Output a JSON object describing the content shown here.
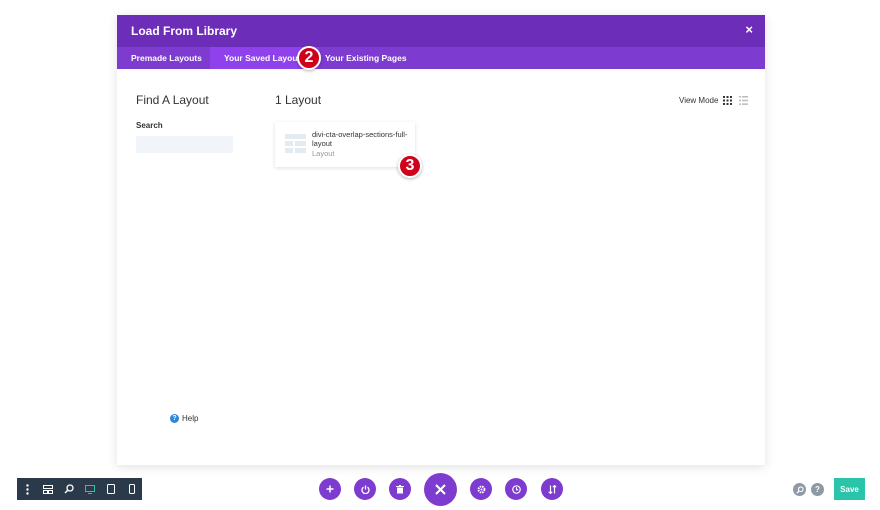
{
  "modal": {
    "title": "Load From Library",
    "close_label": "×"
  },
  "tabs": [
    {
      "label": "Premade Layouts",
      "active": false
    },
    {
      "label": "Your Saved Layouts",
      "active": true
    },
    {
      "label": "Your Existing Pages",
      "active": false
    }
  ],
  "annotations": {
    "step_2": "2",
    "step_3": "3"
  },
  "sidebar": {
    "title": "Find A Layout",
    "search_label": "Search",
    "search_value": "",
    "help_label": "Help"
  },
  "results": {
    "count_label": "1 Layout",
    "view_mode_label": "View Mode",
    "active_view": "grid",
    "layouts": [
      {
        "name": "divi-cta-overlap-sections-full-layout",
        "type": "Layout"
      }
    ]
  },
  "toolbar": {
    "left_icons": [
      "more-vertical-icon",
      "wireframe-icon",
      "zoom-icon",
      "desktop-icon",
      "tablet-icon",
      "phone-icon"
    ],
    "center_icons": [
      "add-icon",
      "power-icon",
      "trash-icon",
      "close-icon",
      "settings-icon",
      "history-icon",
      "sort-icon"
    ],
    "save_label": "Save"
  },
  "colors": {
    "header": "#6c2eb9",
    "tabs": "#7e3bd0",
    "active_tab": "#8f42ec",
    "badge": "#d0021b",
    "save": "#29c4a9",
    "toolbar_dark": "#2b3a4a"
  }
}
